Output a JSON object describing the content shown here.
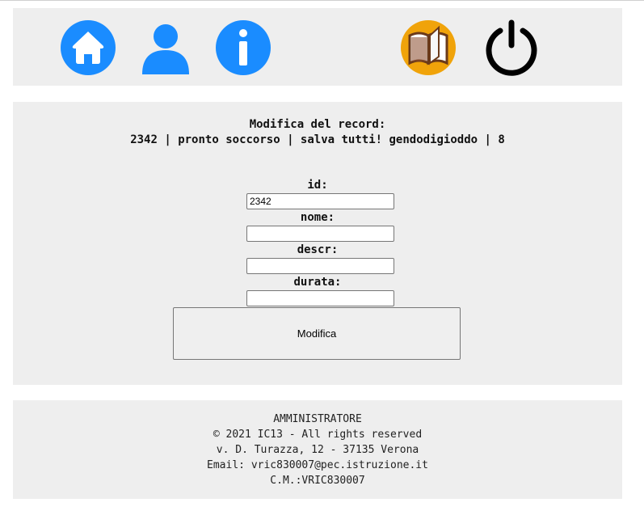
{
  "header": {
    "icons": [
      "home-icon",
      "user-icon",
      "info-icon",
      "book-icon",
      "power-icon"
    ],
    "colors": {
      "blue": "#1a8cff",
      "orange": "#f0a30a",
      "black": "#000000"
    }
  },
  "form": {
    "title": "Modifica del record:",
    "record_summary": "2342 | pronto soccorso | salva tutti! gendodigioddo | 8",
    "fields": [
      {
        "label": "id:",
        "value": "2342"
      },
      {
        "label": "nome:",
        "value": ""
      },
      {
        "label": "descr:",
        "value": ""
      },
      {
        "label": "durata:",
        "value": ""
      }
    ],
    "submit_label": "Modifica"
  },
  "footer": {
    "role": "AMMINISTRATORE",
    "copyright": "© 2021 IC13 - All rights reserved",
    "address": "v. D. Turazza, 12 - 37135 Verona",
    "email": "Email: vric830007@pec.istruzione.it",
    "code": "C.M.:VRIC830007"
  }
}
